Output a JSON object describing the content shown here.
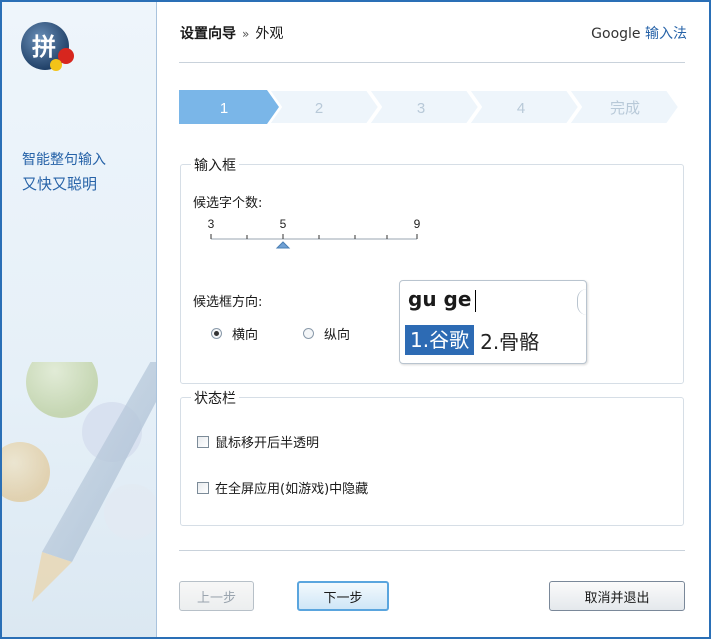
{
  "sidebar": {
    "logo_char": "拼",
    "tagline_line1": "智能整句输入",
    "tagline_line2": "又快又聪明"
  },
  "header": {
    "wizard_title": "设置向导",
    "separator": "»",
    "current_page": "外观",
    "brand_en": "Google",
    "brand_cn": "输入法"
  },
  "steps": {
    "current_index": 1,
    "items": [
      "1",
      "2",
      "3",
      "4",
      "完成"
    ],
    "colors": {
      "active": "#7ab6e8",
      "inactive": "#eef5fb",
      "active_text": "#ffffff",
      "inactive_text": "#b8c9d8"
    }
  },
  "input_box_group": {
    "title": "输入框",
    "candidate_count_label": "候选字个数:",
    "slider": {
      "min_label": "3",
      "mid_label": "5",
      "max_label": "9",
      "value": 5,
      "min": 3,
      "max": 9
    },
    "orientation_label": "候选框方向:",
    "orientation_options": [
      "横向",
      "纵向"
    ],
    "orientation_selected": "横向",
    "preview": {
      "pinyin": "gu ge",
      "candidates": [
        "1.谷歌",
        "2.骨骼"
      ],
      "selected_index": 0,
      "highlight_color": "#2d6bb4"
    }
  },
  "status_bar_group": {
    "title": "状态栏",
    "options": [
      {
        "label": "鼠标移开后半透明",
        "checked": false
      },
      {
        "label": "在全屏应用(如游戏)中隐藏",
        "checked": false
      }
    ]
  },
  "footer": {
    "prev_label": "上一步",
    "next_label": "下一步",
    "cancel_label": "取消并退出"
  },
  "colors": {
    "frame": "#2a6fb6",
    "tagline": "#2763a8",
    "focus_border": "#5aa5de"
  }
}
